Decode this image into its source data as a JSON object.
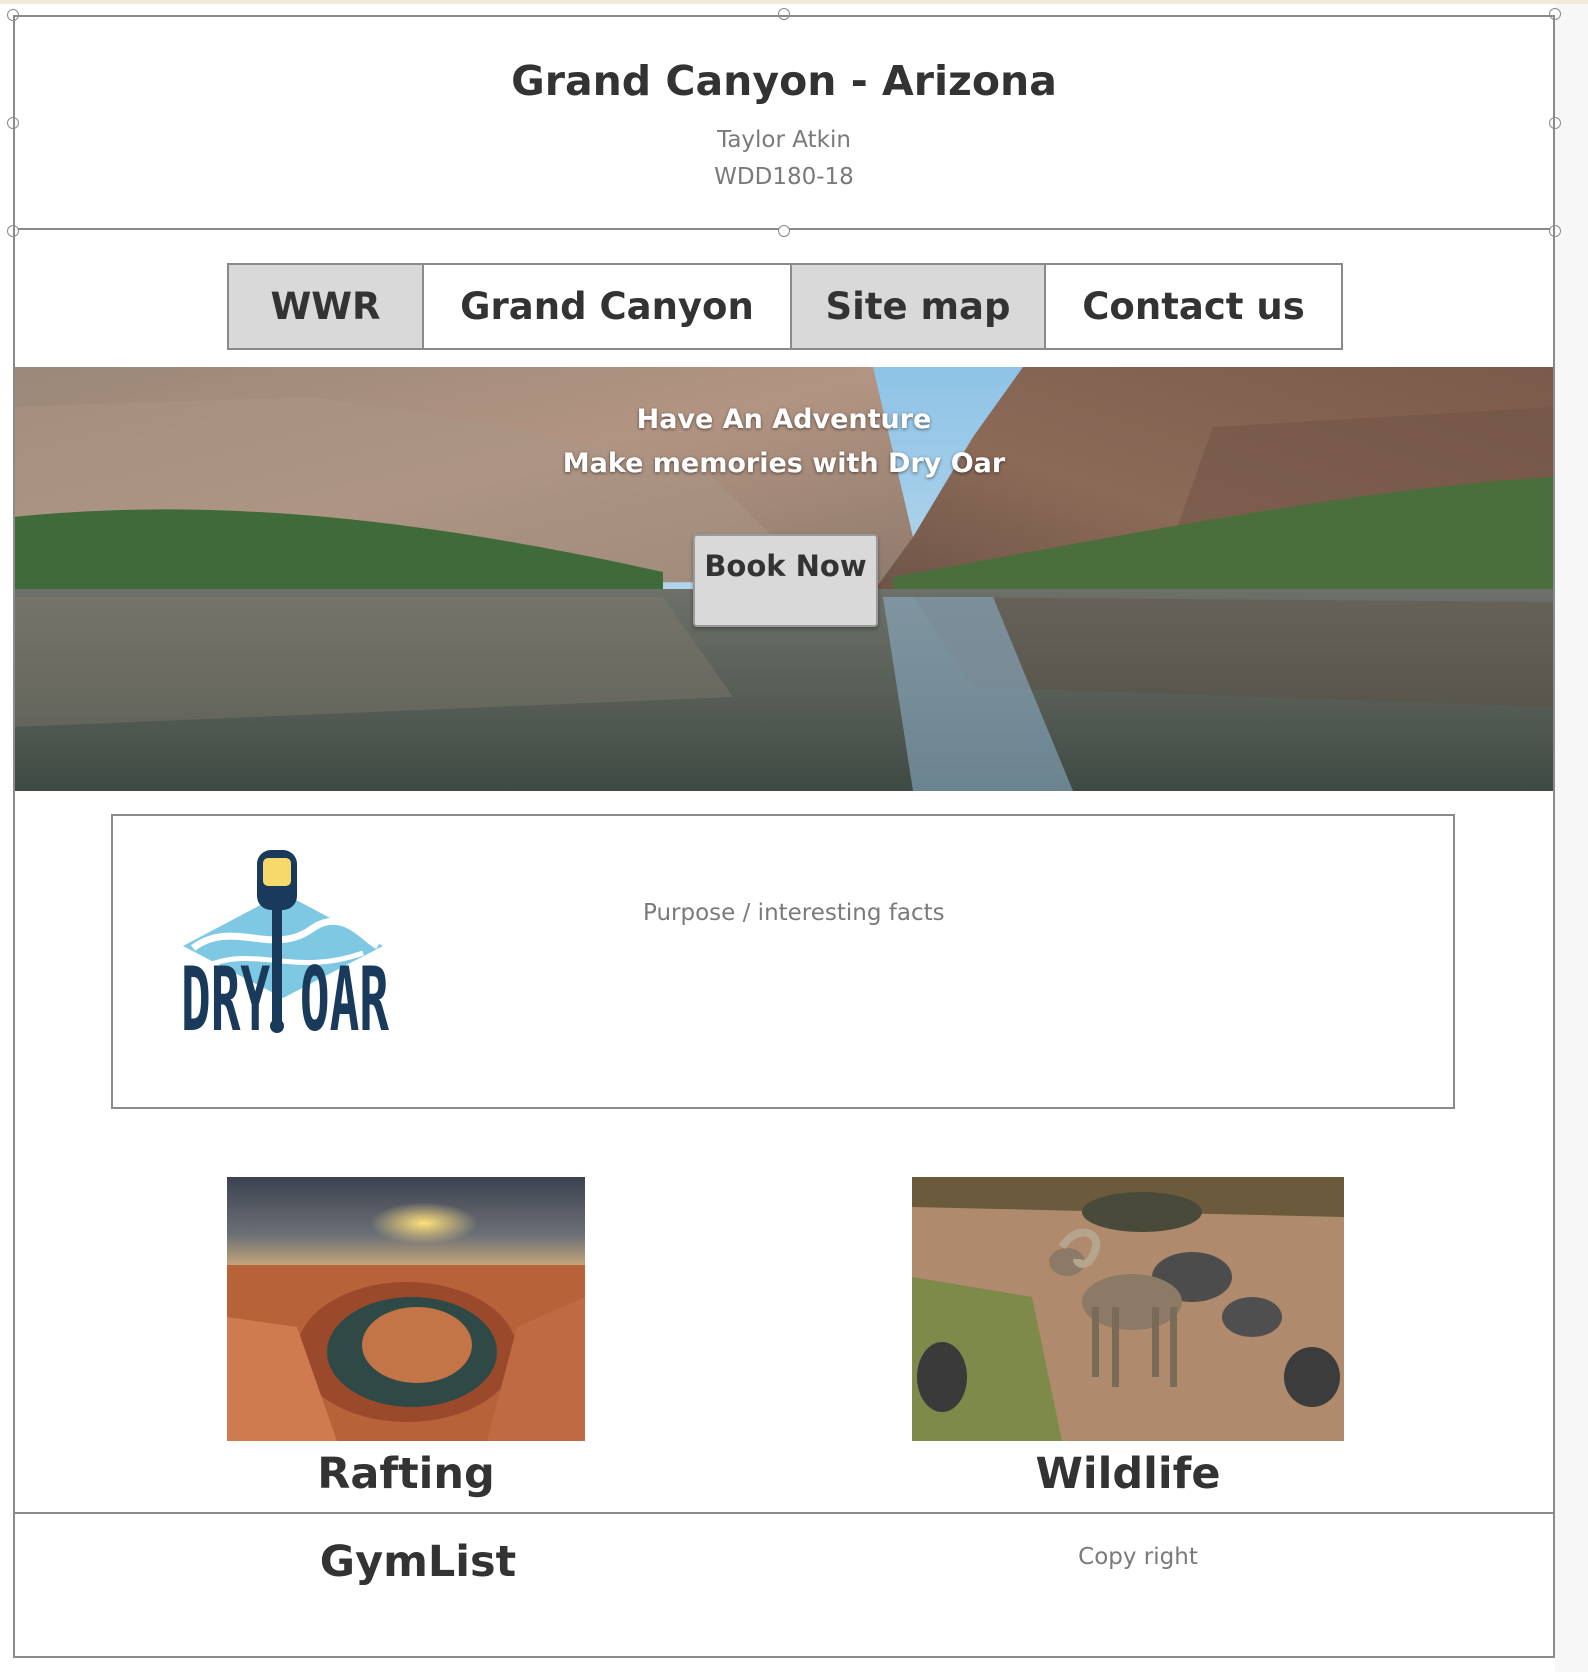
{
  "header": {
    "title": "Grand Canyon - Arizona",
    "author": "Taylor Atkin",
    "course": "WDD180-18"
  },
  "nav": {
    "items": [
      {
        "label": "WWR"
      },
      {
        "label": "Grand Canyon"
      },
      {
        "label": "Site map"
      },
      {
        "label": "Contact us"
      }
    ]
  },
  "hero": {
    "line1": "Have An Adventure",
    "line2": "Make memories with Dry Oar",
    "button_label": "Book Now"
  },
  "about": {
    "logo_text": "DRY OAR",
    "text": "Purpose / interesting facts"
  },
  "cards": [
    {
      "caption": "Rafting",
      "image_icon": "horseshoe-bend-photo"
    },
    {
      "caption": "Wildlife",
      "image_icon": "bighorn-sheep-photo"
    }
  ],
  "footer": {
    "left": "GymList",
    "right": "Copy right"
  },
  "colors": {
    "border": "#8a8a8a",
    "nav_highlight": "#d9d9d9",
    "logo_navy": "#1a3a5c",
    "logo_sky": "#7ec8e3",
    "logo_yellow": "#f6d86b"
  }
}
